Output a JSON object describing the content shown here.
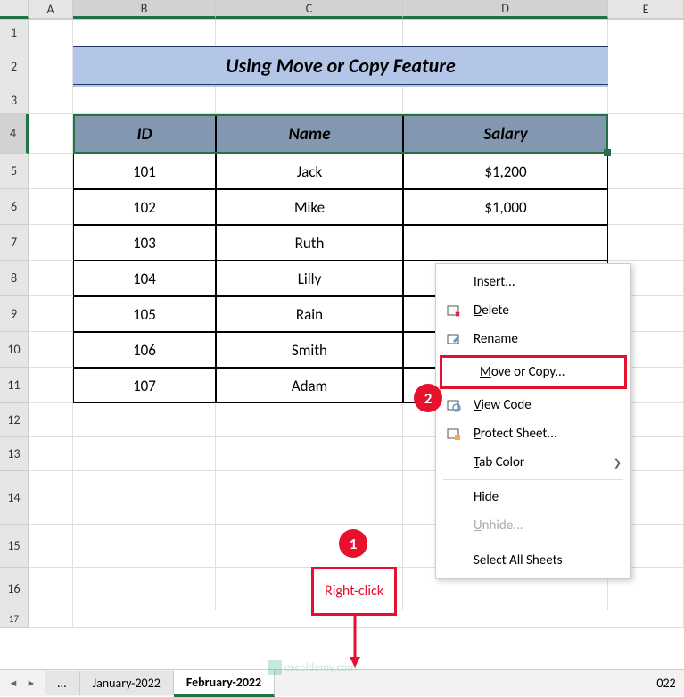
{
  "columns": [
    "A",
    "B",
    "C",
    "D",
    "E"
  ],
  "title": "Using Move or Copy Feature",
  "table": {
    "headers": [
      "ID",
      "Name",
      "Salary"
    ],
    "rows": [
      {
        "id": "101",
        "name": "Jack",
        "salary": "$1,200"
      },
      {
        "id": "102",
        "name": "Mike",
        "salary": "$1,000"
      },
      {
        "id": "103",
        "name": "Ruth",
        "salary": ""
      },
      {
        "id": "104",
        "name": "Lilly",
        "salary": ""
      },
      {
        "id": "105",
        "name": "Rain",
        "salary": ""
      },
      {
        "id": "106",
        "name": "Smith",
        "salary": ""
      },
      {
        "id": "107",
        "name": "Adam",
        "salary": ""
      }
    ]
  },
  "tabs": {
    "prev": "January-2022",
    "active": "February-2022",
    "ellipsis": "...",
    "scroll_label": "022"
  },
  "context_menu": {
    "insert": "Insert...",
    "delete": "Delete",
    "rename": "Rename",
    "move_copy": "Move or Copy...",
    "view_code": "View Code",
    "protect": "Protect Sheet...",
    "tab_color": "Tab Color",
    "hide": "Hide",
    "unhide": "Unhide...",
    "select_all": "Select All Sheets"
  },
  "annotations": {
    "step1": "1",
    "step2": "2",
    "right_click": "Right-click"
  },
  "watermark": "exceldemy.com"
}
